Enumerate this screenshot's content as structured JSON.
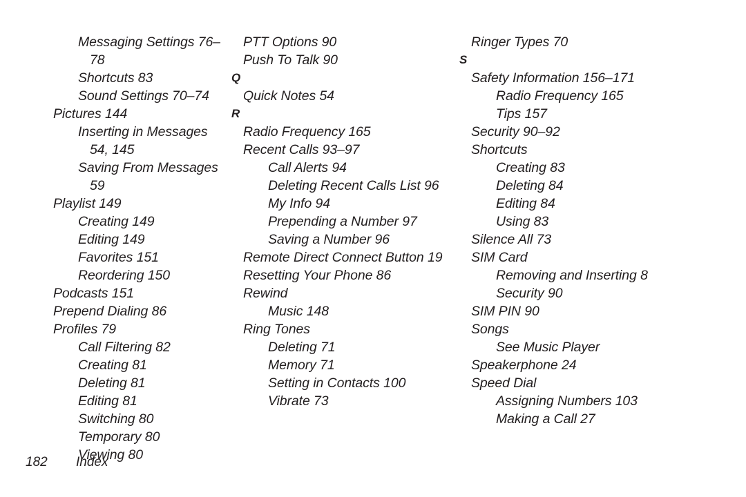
{
  "page": {
    "background_color": "#ffffff",
    "text_color": "#231f20",
    "footer": {
      "page_number": "182",
      "label": "Index"
    }
  },
  "columns": [
    {
      "id": "column-1",
      "lines": [
        {
          "kind": "entry",
          "level": 2,
          "text": "Messaging Settings 76–78"
        },
        {
          "kind": "entry",
          "level": 2,
          "text": "Shortcuts 83"
        },
        {
          "kind": "entry",
          "level": 2,
          "text": "Sound Settings 70–74"
        },
        {
          "kind": "entry",
          "level": 1,
          "text": "Pictures 144"
        },
        {
          "kind": "entry",
          "level": 2,
          "text": "Inserting in Messages 54, 145"
        },
        {
          "kind": "entry",
          "level": 2,
          "text": "Saving From Messages 59"
        },
        {
          "kind": "entry",
          "level": 1,
          "text": "Playlist 149"
        },
        {
          "kind": "entry",
          "level": 2,
          "text": "Creating 149"
        },
        {
          "kind": "entry",
          "level": 2,
          "text": "Editing 149"
        },
        {
          "kind": "entry",
          "level": 2,
          "text": "Favorites 151"
        },
        {
          "kind": "entry",
          "level": 2,
          "text": "Reordering 150"
        },
        {
          "kind": "entry",
          "level": 1,
          "text": "Podcasts 151"
        },
        {
          "kind": "entry",
          "level": 1,
          "text": "Prepend Dialing 86"
        },
        {
          "kind": "entry",
          "level": 1,
          "text": "Profiles 79"
        },
        {
          "kind": "entry",
          "level": 2,
          "text": "Call Filtering 82"
        },
        {
          "kind": "entry",
          "level": 2,
          "text": "Creating 81"
        },
        {
          "kind": "entry",
          "level": 2,
          "text": "Deleting 81"
        },
        {
          "kind": "entry",
          "level": 2,
          "text": "Editing 81"
        },
        {
          "kind": "entry",
          "level": 2,
          "text": "Switching 80"
        },
        {
          "kind": "entry",
          "level": 2,
          "text": "Temporary 80"
        },
        {
          "kind": "entry",
          "level": 2,
          "text": "Viewing 80"
        }
      ]
    },
    {
      "id": "column-2",
      "lines": [
        {
          "kind": "entry",
          "level": 1,
          "text": "PTT Options 90"
        },
        {
          "kind": "entry",
          "level": 1,
          "text": "Push To Talk 90"
        },
        {
          "kind": "letter",
          "text": "Q"
        },
        {
          "kind": "entry",
          "level": 1,
          "text": "Quick Notes 54"
        },
        {
          "kind": "letter",
          "text": "R"
        },
        {
          "kind": "entry",
          "level": 1,
          "text": "Radio Frequency 165"
        },
        {
          "kind": "entry",
          "level": 1,
          "text": "Recent Calls 93–97"
        },
        {
          "kind": "entry",
          "level": 2,
          "text": "Call Alerts 94"
        },
        {
          "kind": "entry",
          "level": 2,
          "text": "Deleting Recent Calls List 96"
        },
        {
          "kind": "entry",
          "level": 2,
          "text": "My Info 94"
        },
        {
          "kind": "entry",
          "level": 2,
          "text": "Prepending a Number 97"
        },
        {
          "kind": "entry",
          "level": 2,
          "text": "Saving a Number 96"
        },
        {
          "kind": "entry",
          "level": 1,
          "text": "Remote Direct Connect Button 19"
        },
        {
          "kind": "entry",
          "level": 1,
          "text": "Resetting Your Phone 86"
        },
        {
          "kind": "entry",
          "level": 1,
          "text": "Rewind"
        },
        {
          "kind": "entry",
          "level": 2,
          "text": "Music 148"
        },
        {
          "kind": "entry",
          "level": 1,
          "text": "Ring Tones"
        },
        {
          "kind": "entry",
          "level": 2,
          "text": "Deleting 71"
        },
        {
          "kind": "entry",
          "level": 2,
          "text": "Memory 71"
        },
        {
          "kind": "entry",
          "level": 2,
          "text": "Setting in Contacts 100"
        },
        {
          "kind": "entry",
          "level": 2,
          "text": "Vibrate 73"
        }
      ]
    },
    {
      "id": "column-3",
      "lines": [
        {
          "kind": "entry",
          "level": 1,
          "text": "Ringer Types 70"
        },
        {
          "kind": "letter",
          "text": "S"
        },
        {
          "kind": "entry",
          "level": 1,
          "text": "Safety Information 156–171"
        },
        {
          "kind": "entry",
          "level": 2,
          "text": "Radio Frequency 165"
        },
        {
          "kind": "entry",
          "level": 2,
          "text": "Tips 157"
        },
        {
          "kind": "entry",
          "level": 1,
          "text": "Security 90–92"
        },
        {
          "kind": "entry",
          "level": 1,
          "text": "Shortcuts"
        },
        {
          "kind": "entry",
          "level": 2,
          "text": "Creating 83"
        },
        {
          "kind": "entry",
          "level": 2,
          "text": "Deleting 84"
        },
        {
          "kind": "entry",
          "level": 2,
          "text": "Editing 84"
        },
        {
          "kind": "entry",
          "level": 2,
          "text": "Using 83"
        },
        {
          "kind": "entry",
          "level": 1,
          "text": "Silence All 73"
        },
        {
          "kind": "entry",
          "level": 1,
          "text": "SIM Card"
        },
        {
          "kind": "entry",
          "level": 2,
          "text": "Removing and Inserting 8"
        },
        {
          "kind": "entry",
          "level": 2,
          "text": "Security 90"
        },
        {
          "kind": "entry",
          "level": 1,
          "text": "SIM PIN 90"
        },
        {
          "kind": "entry",
          "level": 1,
          "text": "Songs"
        },
        {
          "kind": "entry",
          "level": 2,
          "text": "See Music Player"
        },
        {
          "kind": "entry",
          "level": 1,
          "text": "Speakerphone 24"
        },
        {
          "kind": "entry",
          "level": 1,
          "text": "Speed Dial"
        },
        {
          "kind": "entry",
          "level": 2,
          "text": "Assigning Numbers 103"
        },
        {
          "kind": "entry",
          "level": 2,
          "text": "Making a Call 27"
        }
      ]
    }
  ]
}
